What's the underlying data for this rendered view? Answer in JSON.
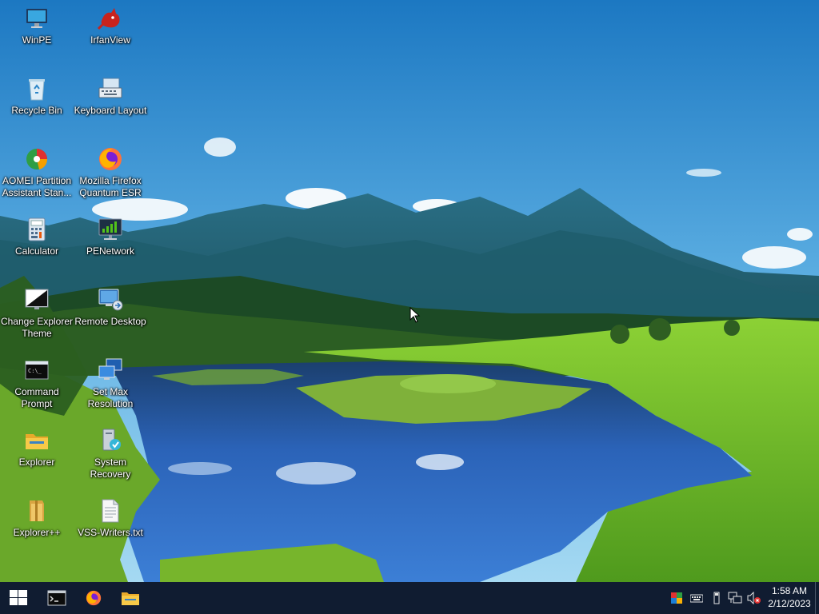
{
  "desktop": {
    "icons": [
      {
        "label": "WinPE",
        "icon": "monitor-icon"
      },
      {
        "label": "IrfanView",
        "icon": "irfanview-cat-icon"
      },
      {
        "label": "Recycle Bin",
        "icon": "recycle-bin-icon"
      },
      {
        "label": "Keyboard Layout",
        "icon": "keyboard-icon"
      },
      {
        "label": "AOMEI Partition Assistant Stan...",
        "icon": "aomei-partition-icon"
      },
      {
        "label": "Mozilla Firefox Quantum ESR",
        "icon": "firefox-icon"
      },
      {
        "label": "Calculator",
        "icon": "calculator-icon"
      },
      {
        "label": "PENetwork",
        "icon": "network-monitor-icon"
      },
      {
        "label": "Change Explorer Theme",
        "icon": "theme-icon"
      },
      {
        "label": "Remote Desktop",
        "icon": "remote-desktop-icon"
      },
      {
        "label": "Command Prompt",
        "icon": "cmd-icon"
      },
      {
        "label": "Set Max Resolution",
        "icon": "display-settings-icon"
      },
      {
        "label": "Explorer",
        "icon": "folder-icon"
      },
      {
        "label": "System Recovery",
        "icon": "system-recovery-icon"
      },
      {
        "label": "Explorer++",
        "icon": "folder-plus-icon"
      },
      {
        "label": "VSS-Writers.txt",
        "icon": "text-file-icon"
      }
    ]
  },
  "taskbar": {
    "pinned": [
      {
        "name": "Start",
        "icon": "windows-logo-icon"
      },
      {
        "name": "Command Prompt",
        "icon": "cmd-icon"
      },
      {
        "name": "Firefox",
        "icon": "firefox-icon"
      },
      {
        "name": "File Explorer",
        "icon": "folder-icon"
      }
    ],
    "tray_icons": [
      "color-palette-icon",
      "keyboard-icon",
      "usb-icon",
      "network-icon",
      "volume-muted-icon"
    ],
    "clock": {
      "time": "1:58 AM",
      "date": "2/12/2023"
    }
  },
  "colors": {
    "taskbar_bg": "#101c31",
    "sky_top": "#1f7fc6",
    "grass": "#6fb52c",
    "water": "#1f55b0"
  }
}
